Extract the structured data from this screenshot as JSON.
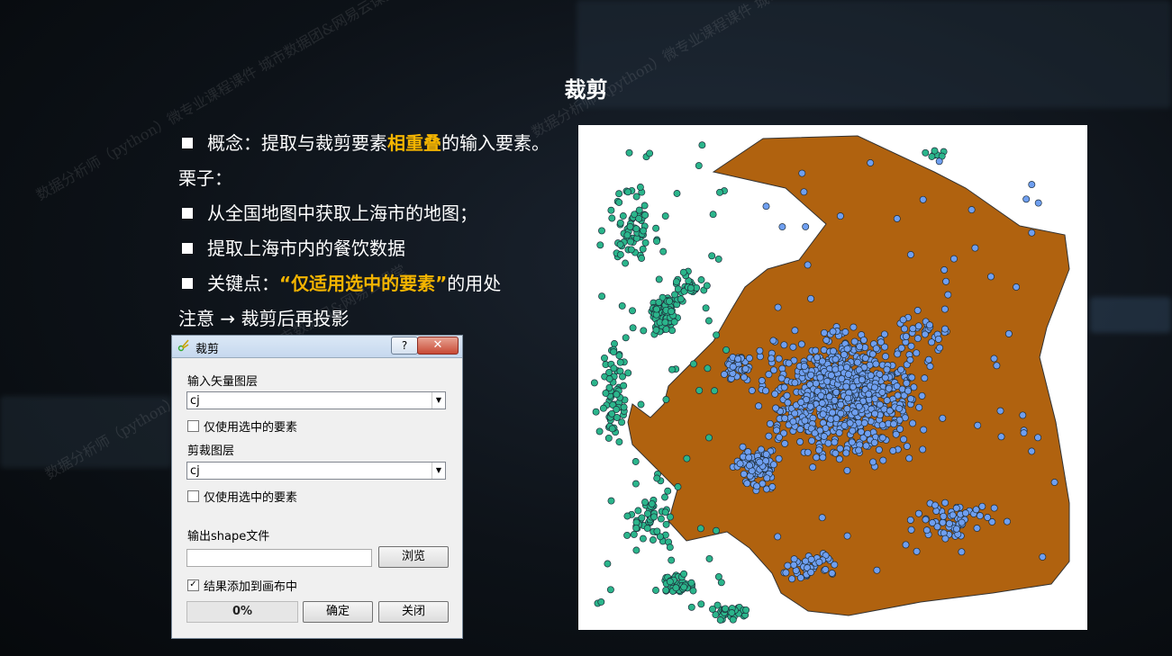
{
  "slide": {
    "title": "裁剪",
    "lines": [
      {
        "pre": "概念：提取与裁剪要素",
        "highlight": "相重叠",
        "post": "的输入要素。",
        "bullet": true
      },
      {
        "pre": "栗子：",
        "highlight": "",
        "post": "",
        "bullet": false
      },
      {
        "pre": "从全国地图中获取上海市的地图；",
        "highlight": "",
        "post": "",
        "bullet": true
      },
      {
        "pre": "提取上海市内的餐饮数据",
        "highlight": "",
        "post": "",
        "bullet": true
      },
      {
        "pre": "关键点：",
        "highlight": "“仅适用选中的要素”",
        "post": "的用处",
        "bullet": true
      },
      {
        "pre": "注意 → 裁剪后再投影",
        "highlight": "",
        "post": "",
        "bullet": false
      }
    ],
    "watermark": "数据分析师（python）微专业课程课件 城市数据团&网易云课堂",
    "highlight_color": "#f4b400"
  },
  "dialog": {
    "title": "裁剪",
    "help_label": "?",
    "close_label": "✕",
    "input_layer_label": "输入矢量图层",
    "input_layer_value": "cj",
    "input_selected_only_label": "仅使用选中的要素",
    "input_selected_only_checked": false,
    "clip_layer_label": "剪裁图层",
    "clip_layer_value": "cj",
    "clip_selected_only_label": "仅使用选中的要素",
    "clip_selected_only_checked": false,
    "output_label": "输出shape文件",
    "output_value": "",
    "browse_label": "浏览",
    "add_to_canvas_label": "结果添加到画布中",
    "add_to_canvas_checked": true,
    "progress_text": "0%",
    "progress": 0,
    "ok_label": "确定",
    "close_button_label": "关闭"
  },
  "map": {
    "region_color": "#b0620f",
    "inside_point_color": "#6f9ff0",
    "outside_point_color": "#2bb58b"
  }
}
